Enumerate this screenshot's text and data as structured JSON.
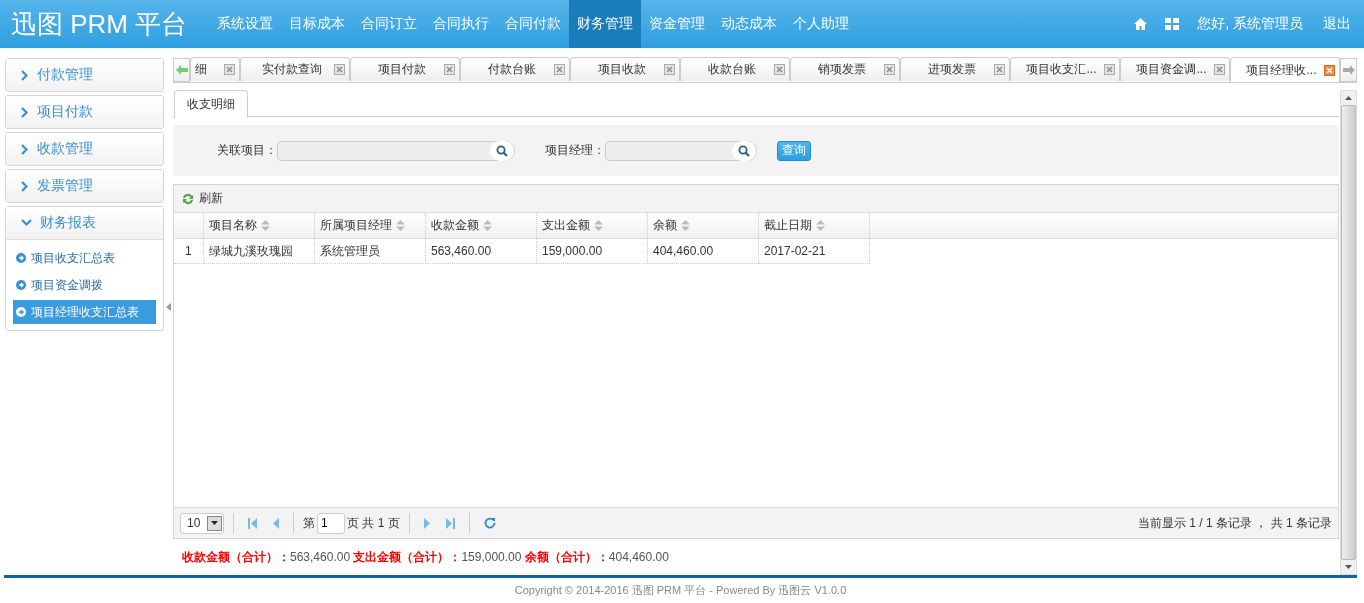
{
  "header": {
    "logo": "迅图 PRM 平台",
    "nav": [
      {
        "label": "系统设置",
        "selected": false
      },
      {
        "label": "目标成本",
        "selected": false
      },
      {
        "label": "合同订立",
        "selected": false
      },
      {
        "label": "合同执行",
        "selected": false
      },
      {
        "label": "合同付款",
        "selected": false
      },
      {
        "label": "财务管理",
        "selected": true
      },
      {
        "label": "资金管理",
        "selected": false
      },
      {
        "label": "动态成本",
        "selected": false
      },
      {
        "label": "个人助理",
        "selected": false
      }
    ],
    "greeting": "您好, 系统管理员",
    "logout": "退出"
  },
  "sidebar": [
    {
      "label": "付款管理",
      "expanded": false
    },
    {
      "label": "项目付款",
      "expanded": false
    },
    {
      "label": "收款管理",
      "expanded": false
    },
    {
      "label": "发票管理",
      "expanded": false
    },
    {
      "label": "财务报表",
      "expanded": true,
      "items": [
        {
          "label": "项目收支汇总表",
          "selected": false
        },
        {
          "label": "项目资金调拨",
          "selected": false
        },
        {
          "label": "项目经理收支汇总表",
          "selected": true
        }
      ]
    }
  ],
  "tabs": [
    {
      "label": "细",
      "selected": false
    },
    {
      "label": "实付款查询",
      "selected": false
    },
    {
      "label": "项目付款",
      "selected": false
    },
    {
      "label": "付款台账",
      "selected": false
    },
    {
      "label": "项目收款",
      "selected": false
    },
    {
      "label": "收款台账",
      "selected": false
    },
    {
      "label": "销项发票",
      "selected": false
    },
    {
      "label": "进项发票",
      "selected": false
    },
    {
      "label": "项目收支汇...",
      "selected": false
    },
    {
      "label": "项目资金调...",
      "selected": false
    },
    {
      "label": "项目经理收...",
      "selected": true
    }
  ],
  "subtabs": [
    {
      "label": "收支明细",
      "selected": true
    }
  ],
  "search": {
    "fields": [
      {
        "label": "关联项目："
      },
      {
        "label": "项目经理："
      }
    ],
    "button": "查询"
  },
  "toolbar": {
    "refresh": "刷新"
  },
  "table": {
    "columns": [
      "项目名称",
      "所属项目经理",
      "收款金额",
      "支出金额",
      "余额",
      "截止日期"
    ],
    "rows": [
      {
        "index": "1",
        "cells": [
          "绿城九溪玫瑰园",
          "系统管理员",
          "563,460.00",
          "159,000.00",
          "404,460.00",
          "2017-02-21"
        ]
      }
    ]
  },
  "pager": {
    "page_size": "10",
    "page_prefix": "第",
    "page": "1",
    "page_suffix": "页 共 1 页",
    "summary": "当前显示 1 / 1 条记录 ， 共 1 条记录"
  },
  "totals": "**收款金额（合计）：**563,460.00 **支出金额（合计）：**159,000.00 **余额（合计）：**404,460.00",
  "footer": "Copyright © 2014-2016 迅图 PRM 平台 - Powered By 迅图云 V1.0.0"
}
